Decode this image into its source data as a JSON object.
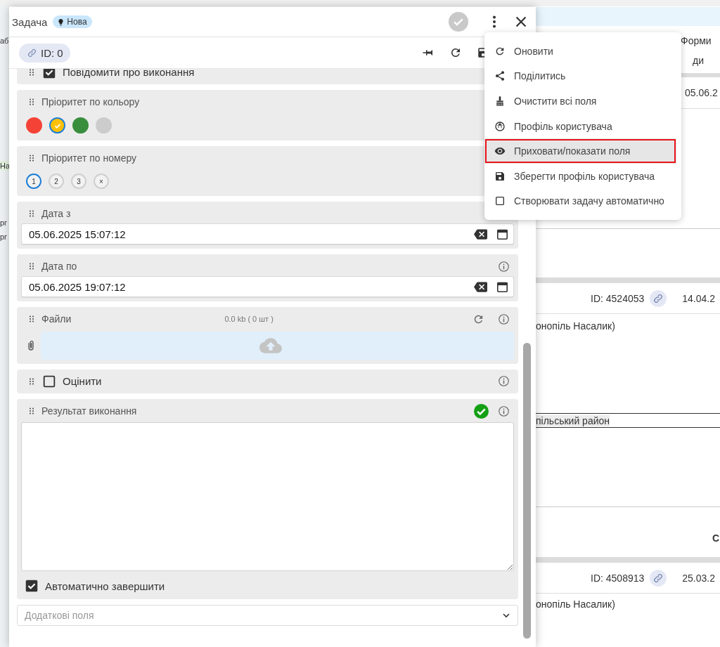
{
  "background_page": {
    "edge_cells": [
      "аб",
      "На",
      "рг",
      "рг"
    ],
    "panel": [
      {
        "kind": "top_bar"
      },
      {
        "kind": "header",
        "text": "Форми"
      },
      {
        "kind": "subheader",
        "text": "ди"
      },
      {
        "kind": "band"
      },
      {
        "kind": "date",
        "text": "05.06.2"
      },
      {
        "kind": "rule"
      },
      {
        "kind": "band"
      },
      {
        "kind": "id_row",
        "id": "ID: 4524053",
        "date": "14.04.2"
      },
      {
        "kind": "text",
        "text": "онопіль Насалик)"
      },
      {
        "kind": "marked_text",
        "text": "пільський район"
      },
      {
        "kind": "rule"
      },
      {
        "kind": "bold",
        "text": "С"
      },
      {
        "kind": "band"
      },
      {
        "kind": "id_row",
        "id": "ID: 4508913",
        "date": "25.03.2"
      },
      {
        "kind": "text",
        "text": "онопіль Насалик)"
      }
    ]
  },
  "dialog": {
    "title": "Задача",
    "status_badge": "Нова",
    "record_id": "ID: 0",
    "fields": [
      {
        "kind": "checkbox",
        "label": "Повідомити про виконання",
        "checked": true,
        "info": false
      },
      {
        "kind": "color_choice",
        "label": "Пріоритет по кольору",
        "info": false,
        "options": [
          {
            "color": "#f44336",
            "selected": false
          },
          {
            "color": "#ffc107",
            "selected": true
          },
          {
            "color": "#388e3c",
            "selected": false
          },
          {
            "color": "#cccccc",
            "selected": false
          }
        ]
      },
      {
        "kind": "number_choice",
        "label": "Пріоритет по номеру",
        "info": false,
        "options": [
          {
            "text": "1",
            "selected": true
          },
          {
            "text": "2",
            "selected": false
          },
          {
            "text": "3",
            "selected": false
          },
          {
            "text": "×",
            "selected": false
          }
        ]
      },
      {
        "kind": "datetime",
        "label": "Дата з",
        "value": "05.06.2025 15:07:12",
        "info": false
      },
      {
        "kind": "datetime",
        "label": "Дата по",
        "value": "05.06.2025 19:07:12",
        "info": true
      },
      {
        "kind": "files",
        "label": "Файли",
        "summary": "0.0 kb ( 0 шт )",
        "info": true
      },
      {
        "kind": "checkbox",
        "label": "Оцінити",
        "checked": false,
        "info": true
      },
      {
        "kind": "textarea",
        "label": "Результат виконання",
        "valid": true,
        "info": true,
        "auto_complete": {
          "label": "Автоматично завершити",
          "checked": true
        }
      }
    ],
    "extra_fields": {
      "placeholder": "Додаткові поля"
    }
  },
  "menu": {
    "items": [
      {
        "kind": "action",
        "label": "Оновити",
        "selected": false
      },
      {
        "kind": "action",
        "label": "Поділитись",
        "selected": false
      },
      {
        "kind": "action",
        "label": "Очистити всі поля",
        "selected": false
      },
      {
        "kind": "action",
        "label": "Профіль користувача",
        "selected": false
      },
      {
        "kind": "action",
        "label": "Приховати/показати поля",
        "selected": true
      },
      {
        "kind": "action",
        "label": "Зберегти профіль користувача",
        "selected": false
      },
      {
        "kind": "checkbox",
        "label": "Створювати задачу автоматично",
        "checked": false,
        "selected": false
      }
    ]
  }
}
